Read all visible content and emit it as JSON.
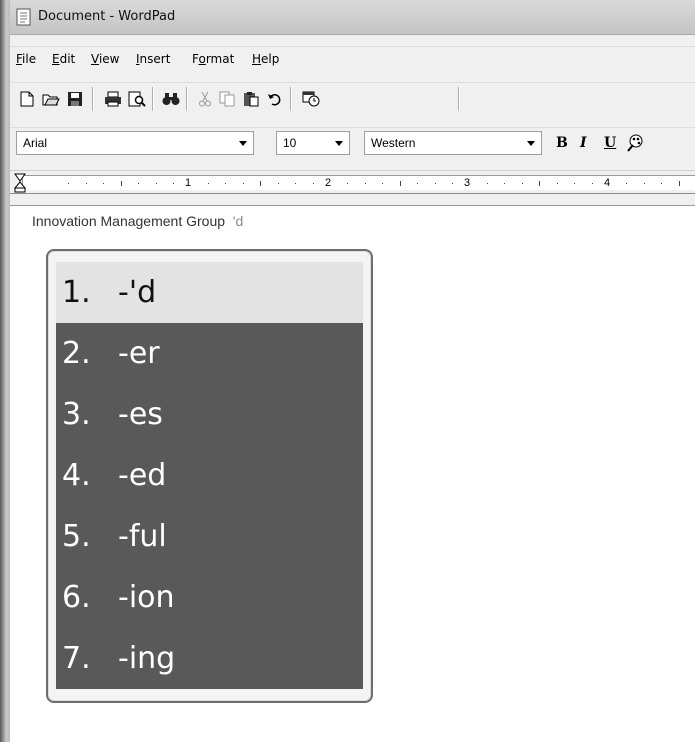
{
  "window": {
    "title": "Document - WordPad"
  },
  "menu": [
    {
      "label": "File",
      "underline": "F",
      "rest": "ile"
    },
    {
      "label": "Edit",
      "underline": "E",
      "rest": "dit"
    },
    {
      "label": "View",
      "underline": "V",
      "rest": "iew"
    },
    {
      "label": "Insert",
      "underline": "I",
      "rest": "nsert"
    },
    {
      "label": "Format",
      "pre": "F",
      "underline": "o",
      "rest": "rmat"
    },
    {
      "label": "Help",
      "underline": "H",
      "rest": "elp"
    }
  ],
  "toolbar": {
    "icons": [
      "new-document-icon",
      "open-folder-icon",
      "save-disk-icon",
      "print-icon",
      "print-preview-icon",
      "find-binoculars-icon",
      "cut-scissors-icon",
      "copy-icon",
      "paste-icon",
      "undo-icon",
      "insert-datetime-icon"
    ]
  },
  "format": {
    "font": "Arial",
    "size": "10",
    "script": "Western",
    "bold": "B",
    "italic": "I",
    "underline": "U"
  },
  "ruler": {
    "marks": [
      "1",
      "2",
      "3",
      "4"
    ]
  },
  "document": {
    "text": "Innovation Management Group",
    "pending": "'d"
  },
  "suggestions": [
    {
      "num": "1.",
      "text": "-'d",
      "selected": true
    },
    {
      "num": "2.",
      "text": "-er",
      "selected": false
    },
    {
      "num": "3.",
      "text": "-es",
      "selected": false
    },
    {
      "num": "4.",
      "text": "-ed",
      "selected": false
    },
    {
      "num": "5.",
      "text": "-ful",
      "selected": false
    },
    {
      "num": "6.",
      "text": "-ion",
      "selected": false
    },
    {
      "num": "7.",
      "text": "-ing",
      "selected": false
    }
  ],
  "colors": {
    "suggestion_bg": "#595959",
    "suggestion_selected_bg": "#e3e3e3"
  }
}
